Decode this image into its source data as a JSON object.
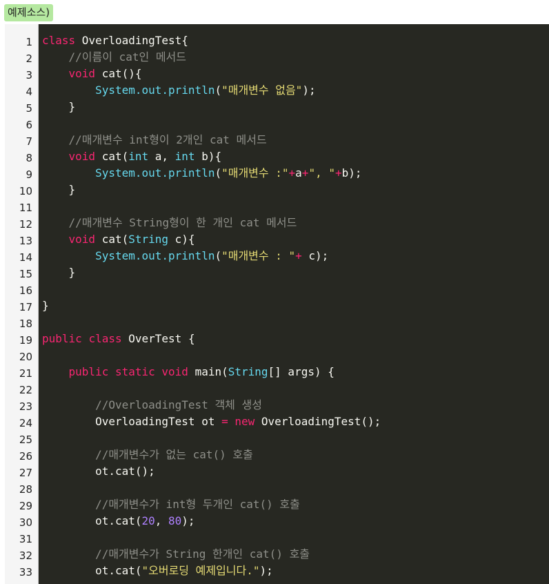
{
  "label": "예제소스)",
  "colors": {
    "background": "#272822",
    "keyword": "#f92672",
    "type": "#66d9ef",
    "string": "#e6db74",
    "comment": "#8f908a",
    "number": "#ae81ff",
    "plain": "#f8f8f2",
    "gutter": "#f5f5f5",
    "label_bg": "#b5e8a0"
  },
  "lines": [
    {
      "n": "1",
      "tokens": [
        [
          "kw",
          "class"
        ],
        [
          "p",
          " OverloadingTest{"
        ]
      ]
    },
    {
      "n": "2",
      "tokens": [
        [
          "p",
          "    "
        ],
        [
          "cm",
          "//이름이 cat인 메서드"
        ]
      ]
    },
    {
      "n": "3",
      "tokens": [
        [
          "p",
          "    "
        ],
        [
          "kw",
          "void"
        ],
        [
          "p",
          " cat(){"
        ]
      ]
    },
    {
      "n": "4",
      "tokens": [
        [
          "p",
          "        "
        ],
        [
          "ty",
          "System.out.println"
        ],
        [
          "p",
          "("
        ],
        [
          "str",
          "\"매개변수 없음\""
        ],
        [
          "p",
          ");"
        ]
      ]
    },
    {
      "n": "5",
      "tokens": [
        [
          "p",
          "    }"
        ]
      ]
    },
    {
      "n": "6",
      "tokens": []
    },
    {
      "n": "7",
      "tokens": [
        [
          "p",
          "    "
        ],
        [
          "cm",
          "//매개변수 int형이 2개인 cat 메서드"
        ]
      ]
    },
    {
      "n": "8",
      "tokens": [
        [
          "p",
          "    "
        ],
        [
          "kw",
          "void"
        ],
        [
          "p",
          " cat("
        ],
        [
          "ty",
          "int"
        ],
        [
          "p",
          " a, "
        ],
        [
          "ty",
          "int"
        ],
        [
          "p",
          " b){"
        ]
      ]
    },
    {
      "n": "9",
      "tokens": [
        [
          "p",
          "        "
        ],
        [
          "ty",
          "System.out.println"
        ],
        [
          "p",
          "("
        ],
        [
          "str",
          "\"매개변수 :\""
        ],
        [
          "kw",
          "+"
        ],
        [
          "p",
          "a"
        ],
        [
          "kw",
          "+"
        ],
        [
          "str",
          "\", \""
        ],
        [
          "kw",
          "+"
        ],
        [
          "p",
          "b);"
        ]
      ]
    },
    {
      "n": "10",
      "tokens": [
        [
          "p",
          "    }"
        ]
      ]
    },
    {
      "n": "11",
      "tokens": []
    },
    {
      "n": "12",
      "tokens": [
        [
          "p",
          "    "
        ],
        [
          "cm",
          "//매개변수 String형이 한 개인 cat 메서드"
        ]
      ]
    },
    {
      "n": "13",
      "tokens": [
        [
          "p",
          "    "
        ],
        [
          "kw",
          "void"
        ],
        [
          "p",
          " cat("
        ],
        [
          "ty",
          "String"
        ],
        [
          "p",
          " c){"
        ]
      ]
    },
    {
      "n": "14",
      "tokens": [
        [
          "p",
          "        "
        ],
        [
          "ty",
          "System.out.println"
        ],
        [
          "p",
          "("
        ],
        [
          "str",
          "\"매개변수 : \""
        ],
        [
          "kw",
          "+"
        ],
        [
          "p",
          " c);"
        ]
      ]
    },
    {
      "n": "15",
      "tokens": [
        [
          "p",
          "    }"
        ]
      ]
    },
    {
      "n": "16",
      "tokens": []
    },
    {
      "n": "17",
      "tokens": [
        [
          "p",
          "}"
        ]
      ]
    },
    {
      "n": "18",
      "tokens": []
    },
    {
      "n": "19",
      "tokens": [
        [
          "kw",
          "public"
        ],
        [
          "p",
          " "
        ],
        [
          "kw",
          "class"
        ],
        [
          "p",
          " OverTest {"
        ]
      ]
    },
    {
      "n": "20",
      "tokens": []
    },
    {
      "n": "21",
      "tokens": [
        [
          "p",
          "    "
        ],
        [
          "kw",
          "public"
        ],
        [
          "p",
          " "
        ],
        [
          "kw",
          "static"
        ],
        [
          "p",
          " "
        ],
        [
          "kw",
          "void"
        ],
        [
          "p",
          " main("
        ],
        [
          "ty",
          "String"
        ],
        [
          "p",
          "[] args) {"
        ]
      ]
    },
    {
      "n": "22",
      "tokens": []
    },
    {
      "n": "23",
      "tokens": [
        [
          "p",
          "        "
        ],
        [
          "cm",
          "//OverloadingTest 객체 생성"
        ]
      ]
    },
    {
      "n": "24",
      "tokens": [
        [
          "p",
          "        OverloadingTest ot "
        ],
        [
          "kw",
          "="
        ],
        [
          "p",
          " "
        ],
        [
          "kw",
          "new"
        ],
        [
          "p",
          " OverloadingTest();"
        ]
      ]
    },
    {
      "n": "25",
      "tokens": []
    },
    {
      "n": "26",
      "tokens": [
        [
          "p",
          "        "
        ],
        [
          "cm",
          "//매개변수가 없는 cat() 호출"
        ]
      ]
    },
    {
      "n": "27",
      "tokens": [
        [
          "p",
          "        ot.cat();"
        ]
      ]
    },
    {
      "n": "28",
      "tokens": []
    },
    {
      "n": "29",
      "tokens": [
        [
          "p",
          "        "
        ],
        [
          "cm",
          "//매개변수가 int형 두개인 cat() 호출"
        ]
      ]
    },
    {
      "n": "30",
      "tokens": [
        [
          "p",
          "        ot.cat("
        ],
        [
          "num",
          "20"
        ],
        [
          "p",
          ", "
        ],
        [
          "num",
          "80"
        ],
        [
          "p",
          ");"
        ]
      ]
    },
    {
      "n": "31",
      "tokens": []
    },
    {
      "n": "32",
      "tokens": [
        [
          "p",
          "        "
        ],
        [
          "cm",
          "//매개변수가 String 한개인 cat() 호출"
        ]
      ]
    },
    {
      "n": "33",
      "tokens": [
        [
          "p",
          "        ot.cat("
        ],
        [
          "str",
          "\"오버로딩 예제입니다.\""
        ],
        [
          "p",
          ");"
        ]
      ]
    }
  ]
}
